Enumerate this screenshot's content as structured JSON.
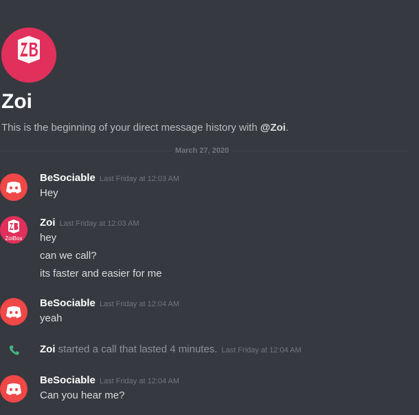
{
  "intro": {
    "logo_text": "ZoiBox",
    "title": "Zoi",
    "description_prefix": "This is the beginning of your direct message history with ",
    "mention": "@Zoi",
    "description_suffix": "."
  },
  "divider": {
    "date": "March 27, 2020"
  },
  "messages": [
    {
      "author": "BeSociable",
      "avatar": "discord-logo-avatar",
      "timestamp": "Last Friday at 12:03 AM",
      "lines": [
        "Hey"
      ]
    },
    {
      "author": "Zoi",
      "avatar": "zoibox-logo-avatar",
      "timestamp": "Last Friday at 12:03 AM",
      "lines": [
        "hey",
        "can we call?",
        "its faster and easier for me"
      ]
    },
    {
      "author": "BeSociable",
      "avatar": "discord-logo-avatar",
      "timestamp": "Last Friday at 12:04 AM",
      "lines": [
        "yeah"
      ]
    },
    {
      "author": "BeSociable",
      "avatar": "discord-logo-avatar",
      "timestamp": "Last Friday at 12:04 AM",
      "lines": [
        "Can you hear me?"
      ]
    }
  ],
  "system_message": {
    "icon": "phone-icon",
    "user": "Zoi",
    "text": " started a call that lasted 4 minutes.",
    "timestamp": "Last Friday at 12:04 AM"
  },
  "colors": {
    "background": "#36393f",
    "discord_red": "#f04747",
    "zoibox_pink": "#e0305b",
    "call_green": "#43b581"
  }
}
